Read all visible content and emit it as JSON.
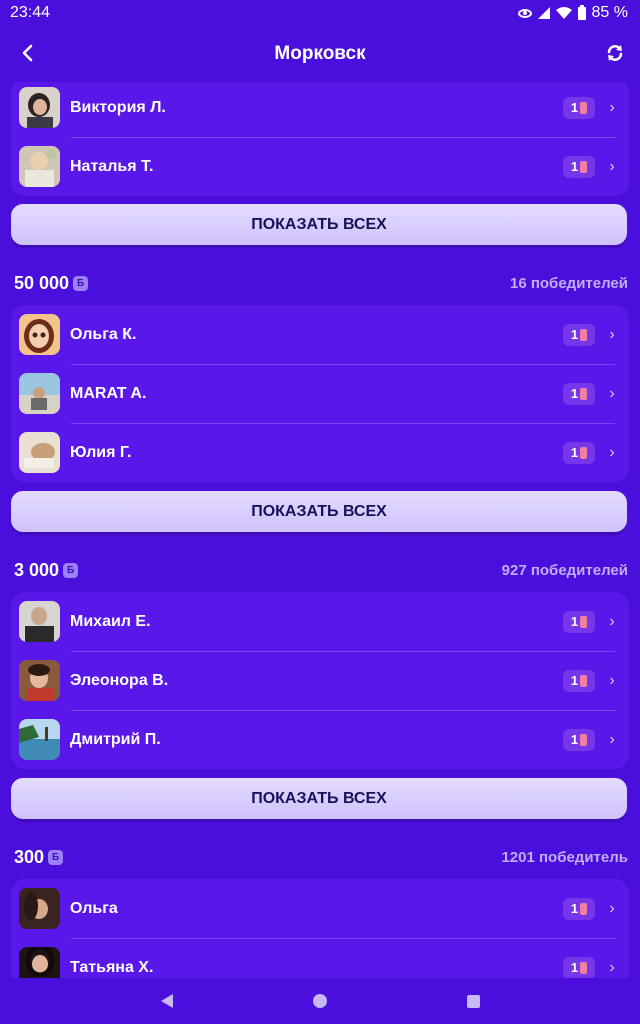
{
  "status": {
    "time": "23:44",
    "battery": "85 %"
  },
  "header": {
    "title": "Морковск"
  },
  "show_all_label": "ПОКАЗАТЬ ВСЕХ",
  "ticket_count": "1",
  "top_card": {
    "rows": [
      {
        "name": "Виктория Л."
      },
      {
        "name": "Наталья Т."
      }
    ]
  },
  "sections": [
    {
      "prize": "50 000",
      "currency": "Б",
      "winners": "16 победителей",
      "rows": [
        {
          "name": "Ольга К."
        },
        {
          "name": "MARAT A."
        },
        {
          "name": "Юлия Г."
        }
      ]
    },
    {
      "prize": "3 000",
      "currency": "Б",
      "winners": "927 победителей",
      "rows": [
        {
          "name": "Михаил Е."
        },
        {
          "name": "Элеонора В."
        },
        {
          "name": "Дмитрий П."
        }
      ]
    },
    {
      "prize": "300",
      "currency": "Б",
      "winners": "1201 победитель",
      "rows": [
        {
          "name": "Ольга"
        },
        {
          "name": "Татьяна Х."
        }
      ]
    }
  ],
  "colors": {
    "background": "#4a0fdc",
    "card": "#5a17ea",
    "button": "#d9ceff",
    "button_text": "#1c0f5b",
    "ticket_badge": "#7736e9"
  }
}
